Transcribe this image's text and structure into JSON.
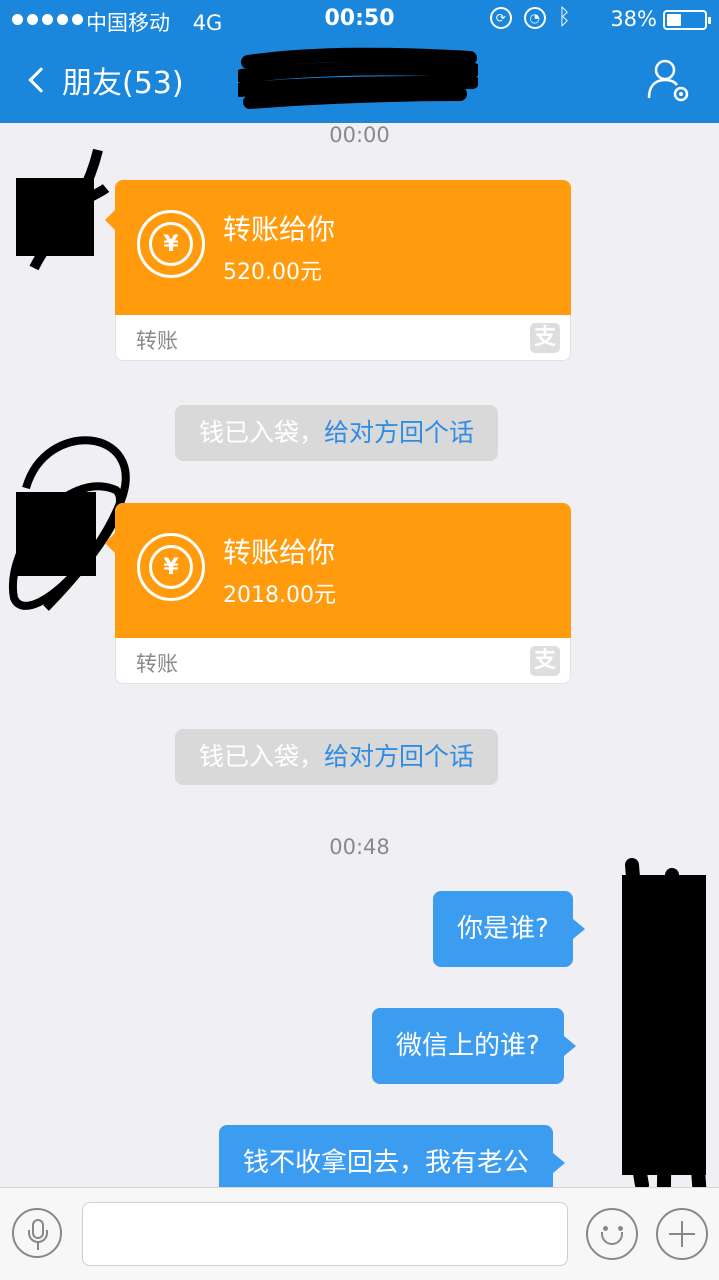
{
  "status_bar": {
    "carrier": "中国移动",
    "network": "4G",
    "time": "00:50",
    "battery_percent": "38%",
    "battery_level": 0.38,
    "icons": [
      "signal-dots",
      "orientation-lock-icon",
      "alarm-icon",
      "bluetooth-icon",
      "battery-icon"
    ]
  },
  "nav": {
    "back_label": "朋友(53)",
    "profile_icon": "profile-settings-icon"
  },
  "colors": {
    "nav_blue": "#1a86dc",
    "transfer_orange": "#ff9b0d",
    "outgoing_bubble": "#3c9cf0",
    "link_blue": "#2f8de4",
    "background": "#efeff4"
  },
  "chat": {
    "timestamps": [
      "00:00",
      "00:48"
    ],
    "transfers": [
      {
        "title": "转账给你",
        "amount": "520.00元",
        "footer": "转账",
        "icon": "currency-transfer-icon"
      },
      {
        "title": "转账给你",
        "amount": "2018.00元",
        "footer": "转账",
        "icon": "currency-transfer-icon"
      }
    ],
    "notices": [
      {
        "text": "钱已入袋，",
        "link": "给对方回个话"
      },
      {
        "text": "钱已入袋，",
        "link": "给对方回个话"
      }
    ],
    "outgoing": [
      "你是谁?",
      "微信上的谁?",
      "钱不收拿回去，我有老公"
    ]
  },
  "input_bar": {
    "placeholder": "",
    "icons": [
      "microphone-icon",
      "emoji-icon",
      "plus-icon"
    ]
  }
}
